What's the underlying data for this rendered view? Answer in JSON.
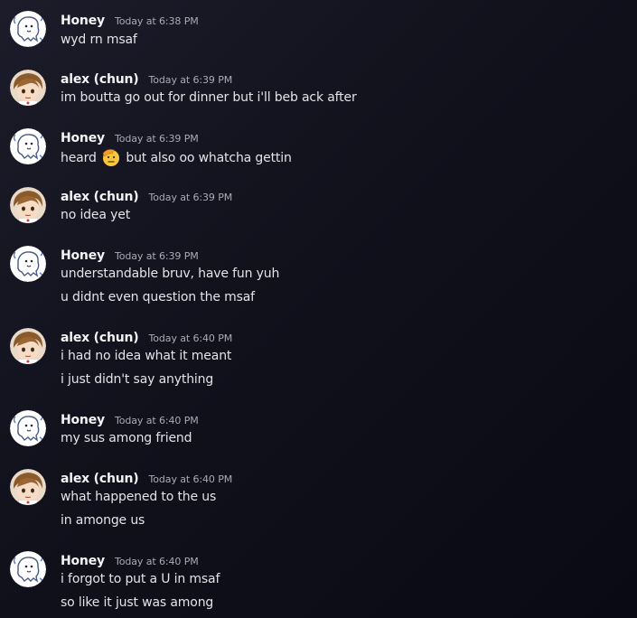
{
  "messages": [
    {
      "author": "Honey",
      "avatar": "honey-avatar",
      "time": "Today at 6:38 PM",
      "lines": [
        "wyd rn msaf"
      ]
    },
    {
      "author": "alex (chun)",
      "avatar": "alex-avatar",
      "time": "Today at 6:39 PM",
      "lines": [
        "im boutta go out for dinner but i'll beb ack after"
      ]
    },
    {
      "author": "Honey",
      "avatar": "honey-avatar",
      "time": "Today at 6:39 PM",
      "lines": [
        "heard",
        "but also oo whatcha gettin"
      ],
      "emoji": "saluting-face-emoji"
    },
    {
      "author": "alex (chun)",
      "avatar": "alex-avatar",
      "time": "Today at 6:39 PM",
      "lines": [
        "no idea yet"
      ]
    },
    {
      "author": "Honey",
      "avatar": "honey-avatar",
      "time": "Today at 6:39 PM",
      "lines": [
        "understandable bruv, have fun yuh",
        "u didnt even question the msaf"
      ]
    },
    {
      "author": "alex (chun)",
      "avatar": "alex-avatar",
      "time": "Today at 6:40 PM",
      "lines": [
        "i had no idea what it meant",
        "i just didn't say anything"
      ]
    },
    {
      "author": "Honey",
      "avatar": "honey-avatar",
      "time": "Today at 6:40 PM",
      "lines": [
        "my sus among friend"
      ]
    },
    {
      "author": "alex (chun)",
      "avatar": "alex-avatar",
      "time": "Today at 6:40 PM",
      "lines": [
        "what happened to the us",
        "in amonge us"
      ]
    },
    {
      "author": "Honey",
      "avatar": "honey-avatar",
      "time": "Today at 6:40 PM",
      "lines": [
        "i forgot to put a U in msaf",
        "so like it just was among"
      ]
    }
  ]
}
